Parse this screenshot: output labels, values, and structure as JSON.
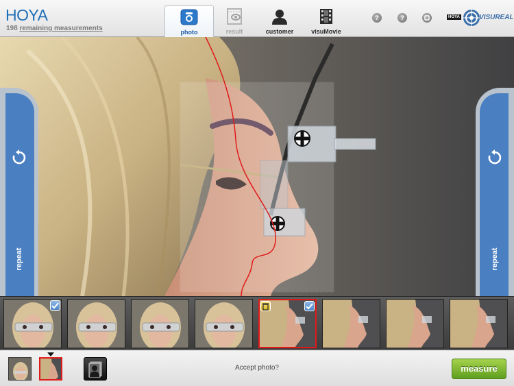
{
  "header": {
    "brand": "HOYA",
    "remaining_count": "198",
    "remaining_label": "remaining measurements",
    "tabs": [
      {
        "label": "photo",
        "icon": "camera-icon",
        "active": true
      },
      {
        "label": "result",
        "icon": "result-eye-icon",
        "active": false
      },
      {
        "label": "customer",
        "icon": "customer-silhouette-icon",
        "active": false
      },
      {
        "label": "visuMovie",
        "icon": "film-strip-icon",
        "active": false
      }
    ],
    "help_buttons": [
      "?",
      "?"
    ],
    "visureal_brand": "HOYA",
    "visureal_label": "VISUREAL"
  },
  "side_panels": {
    "left_label": "repeat",
    "right_label": "repeat"
  },
  "thumbnails": {
    "items": [
      {
        "view": "front",
        "checked": true,
        "selected": false,
        "delete": false
      },
      {
        "view": "front",
        "checked": false,
        "selected": false,
        "delete": false
      },
      {
        "view": "front",
        "checked": false,
        "selected": false,
        "delete": false
      },
      {
        "view": "front",
        "checked": false,
        "selected": false,
        "delete": false
      },
      {
        "view": "side",
        "checked": true,
        "selected": true,
        "delete": true
      },
      {
        "view": "side",
        "checked": false,
        "selected": false,
        "delete": false
      },
      {
        "view": "side",
        "checked": false,
        "selected": false,
        "delete": false
      },
      {
        "view": "side",
        "checked": false,
        "selected": false,
        "delete": false
      }
    ]
  },
  "footer": {
    "prompt": "Accept photo?",
    "measure_label": "measure"
  },
  "colors": {
    "brand_blue": "#1f6fb8",
    "panel_blue": "#4a7fc1",
    "selection_red": "#e01a1a",
    "measure_green": "#7bb536"
  }
}
